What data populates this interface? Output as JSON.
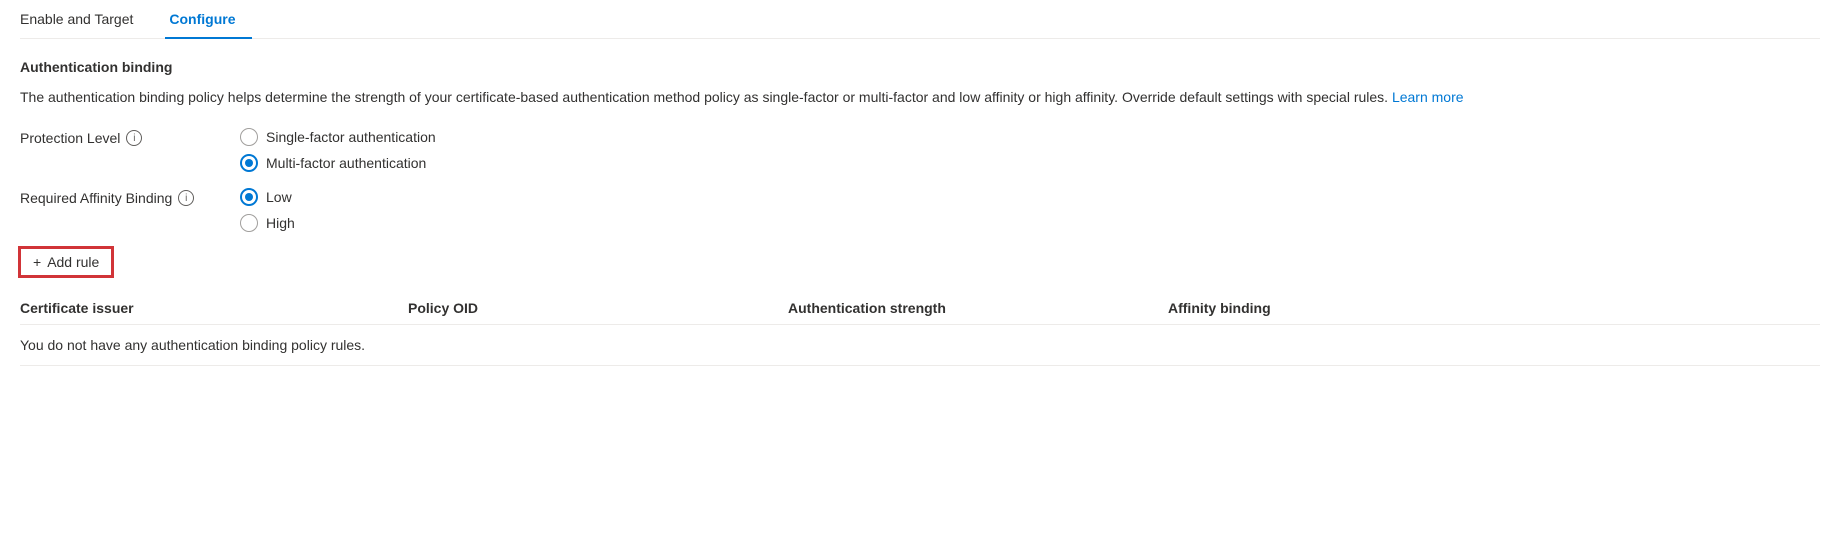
{
  "tabs": [
    {
      "id": "enable-target",
      "label": "Enable and Target",
      "active": false
    },
    {
      "id": "configure",
      "label": "Configure",
      "active": true
    }
  ],
  "section": {
    "title": "Authentication binding",
    "description": "The authentication binding policy helps determine the strength of your certificate-based authentication method policy as single-factor or multi-factor and low affinity or high affinity. Override default settings with special rules.",
    "learn_more_label": "Learn more"
  },
  "protection_level": {
    "label": "Protection Level",
    "info_tooltip": "i",
    "options": [
      {
        "id": "single-factor",
        "label": "Single-factor authentication",
        "selected": false
      },
      {
        "id": "multi-factor",
        "label": "Multi-factor authentication",
        "selected": true
      }
    ]
  },
  "affinity_binding": {
    "label": "Required Affinity Binding",
    "info_tooltip": "i",
    "options": [
      {
        "id": "low",
        "label": "Low",
        "selected": true
      },
      {
        "id": "high",
        "label": "High",
        "selected": false
      }
    ]
  },
  "add_rule_button": {
    "label": "+ Add rule",
    "plus_symbol": "+"
  },
  "table": {
    "columns": [
      {
        "id": "certificate-issuer",
        "label": "Certificate issuer"
      },
      {
        "id": "policy-oid",
        "label": "Policy OID"
      },
      {
        "id": "auth-strength",
        "label": "Authentication strength"
      },
      {
        "id": "affinity-binding",
        "label": "Affinity binding"
      }
    ],
    "empty_message": "You do not have any authentication binding policy rules."
  }
}
